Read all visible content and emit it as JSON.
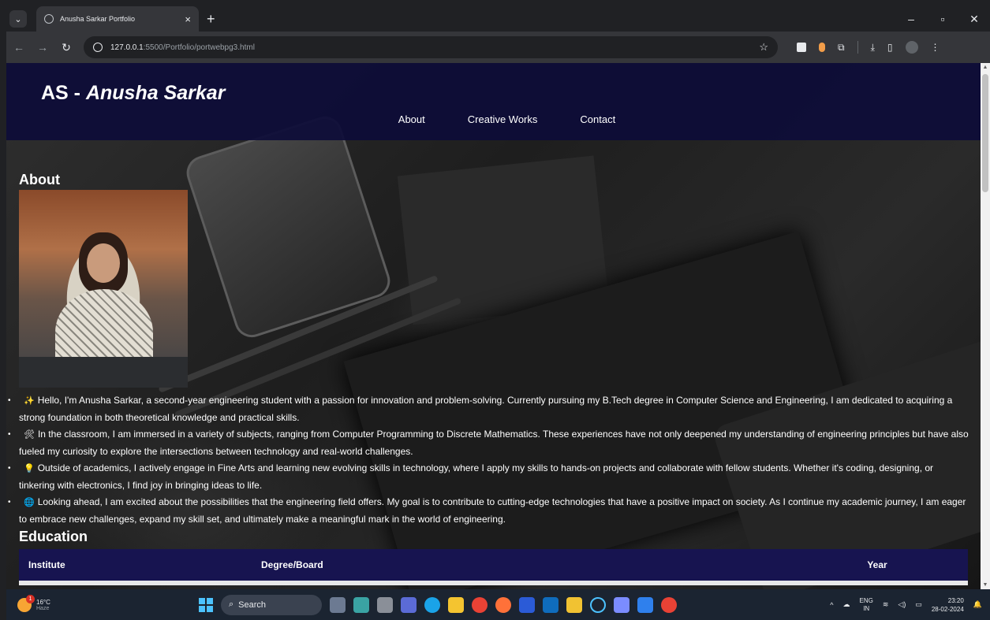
{
  "browser": {
    "tab_title": "Anusha Sarkar Portfolio",
    "url_host": "127.0.0.1",
    "url_rest": ":5500/Portfolio/portwebpg3.html"
  },
  "site": {
    "brand_prefix": "AS - ",
    "brand_name": "Anusha Sarkar",
    "nav": [
      "About",
      "Creative Works",
      "Contact"
    ]
  },
  "about": {
    "heading": "About",
    "paragraphs": [
      {
        "emoji": "✨",
        "text": "Hello, I'm Anusha Sarkar, a second-year engineering student with a passion for innovation and problem-solving. Currently pursuing my B.Tech degree in Computer Science and Engineering, I am dedicated to acquiring a strong foundation in both theoretical knowledge and practical skills."
      },
      {
        "emoji": "🛠",
        "text": "In the classroom, I am immersed in a variety of subjects, ranging from Computer Programming to Discrete Mathematics. These experiences have not only deepened my understanding of engineering principles but have also fueled my curiosity to explore the intersections between technology and real-world challenges."
      },
      {
        "emoji": "💡",
        "text": "Outside of academics, I actively engage in Fine Arts and learning new evolving skills in technology, where I apply my skills to hands-on projects and collaborate with fellow students. Whether it's coding, designing, or tinkering with electronics, I find joy in bringing ideas to life."
      },
      {
        "emoji": "🌐",
        "text": "Looking ahead, I am excited about the possibilities that the engineering field offers. My goal is to contribute to cutting-edge technologies that have a positive impact on society. As I continue my academic journey, I am eager to embrace new challenges, expand my skill set, and ultimately make a meaningful mark in the world of engineering."
      }
    ]
  },
  "education": {
    "heading": "Education",
    "columns": [
      "Institute",
      "Degree/Board",
      "Year"
    ]
  },
  "taskbar": {
    "temp": "16°C",
    "condition": "Haze",
    "notification_count": "1",
    "search_placeholder": "Search",
    "lang_top": "ENG",
    "lang_bottom": "IN",
    "time": "23:20",
    "date": "28-02-2024"
  },
  "colors": {
    "header_bg": "#0d0c38",
    "table_header_bg": "#171450"
  }
}
